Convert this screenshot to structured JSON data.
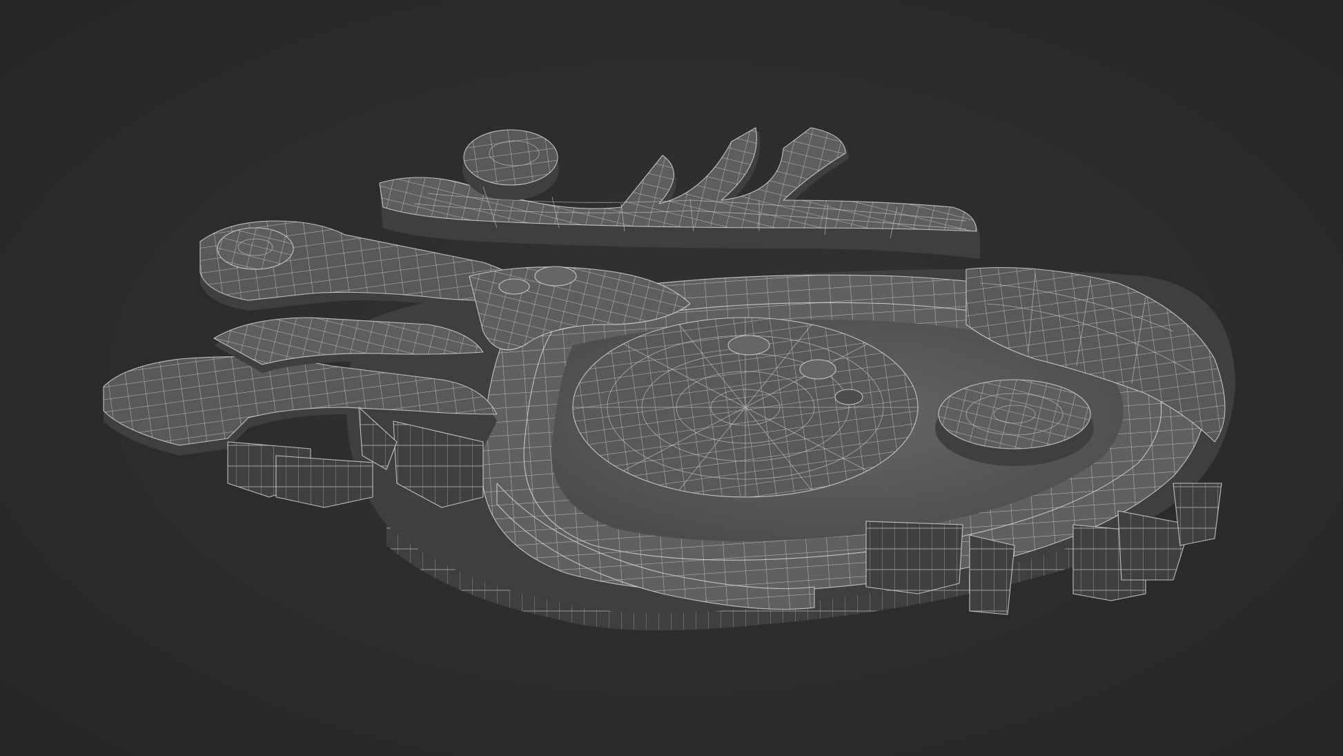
{
  "scene": {
    "background_color": "#2c2c2c",
    "object": "wireframe-ornament",
    "mesh_fill_color": "#555555",
    "wire_color": "#d8d8d8"
  }
}
